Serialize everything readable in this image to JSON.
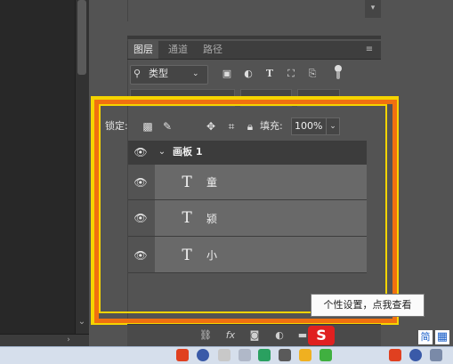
{
  "colors": {
    "panel_bg": "#535353",
    "highlight_yellow": "#f5d400",
    "highlight_orange": "#f07010",
    "layer_row": "#696969",
    "group_row": "#3c3c3c"
  },
  "layers_panel": {
    "tabs": [
      {
        "label": "图层",
        "active": true
      },
      {
        "label": "通道",
        "active": false
      },
      {
        "label": "路径",
        "active": false
      }
    ],
    "menu_icon": "panel-menu-icon",
    "filter": {
      "search_icon": "search-icon",
      "kind_label": "类型",
      "icons": [
        "image-filter-icon",
        "adjustment-filter-icon",
        "type-filter-icon",
        "shape-filter-icon",
        "smart-object-filter-icon"
      ],
      "toggle_icon": "filter-toggle-icon"
    },
    "lock": {
      "label": "锁定:",
      "icons": [
        "lock-transparent-icon",
        "lock-image-icon",
        "lock-position-icon",
        "lock-artboard-icon",
        "lock-all-icon"
      ]
    },
    "fill": {
      "label": "填充:",
      "value": "100%"
    },
    "group": {
      "name": "画板 1",
      "expanded": true
    },
    "layers": [
      {
        "type_glyph": "T",
        "name": "童"
      },
      {
        "type_glyph": "T",
        "name": "颍"
      },
      {
        "type_glyph": "T",
        "name": "小"
      }
    ],
    "bottom_icons": [
      "link-layers-icon",
      "fx-icon",
      "mask-icon",
      "adjustment-layer-icon",
      "folder-icon"
    ],
    "bottom_fx_label": "fx"
  },
  "tooltip": {
    "text": "个性设置，点我查看"
  },
  "ime": {
    "logo_text": "S",
    "mode_char": "简"
  }
}
